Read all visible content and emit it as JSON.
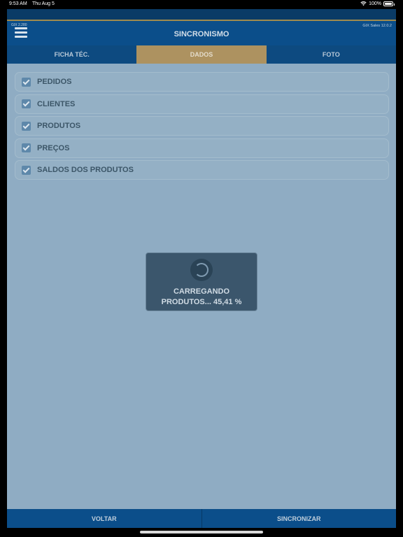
{
  "status_bar": {
    "time": "9:53 AM",
    "date": "Thu Aug 5",
    "battery": "100%"
  },
  "header": {
    "version_left": "GIX 2.280",
    "version_right": "GIX Sales 12.0.2",
    "title": "SINCRONISMO"
  },
  "tabs": [
    {
      "label": "FICHA TÉC.",
      "active": false
    },
    {
      "label": "DADOS",
      "active": true
    },
    {
      "label": "FOTO",
      "active": false
    }
  ],
  "sync_items": [
    {
      "label": "PEDIDOS",
      "checked": true
    },
    {
      "label": "CLIENTES",
      "checked": true
    },
    {
      "label": "PRODUTOS",
      "checked": true
    },
    {
      "label": "PREÇOS",
      "checked": true
    },
    {
      "label": "SALDOS DOS PRODUTOS",
      "checked": true
    }
  ],
  "loading": {
    "line1": "CARREGANDO",
    "line2": "PRODUTOS... 45,41 %"
  },
  "footer": {
    "back_label": "VOLTAR",
    "sync_label": "SINCRONIZAR"
  },
  "colors": {
    "header_blue": "#0b4e8a",
    "active_tab": "#ad9260",
    "background": "#8facc3",
    "overlay": "#3b566c"
  }
}
